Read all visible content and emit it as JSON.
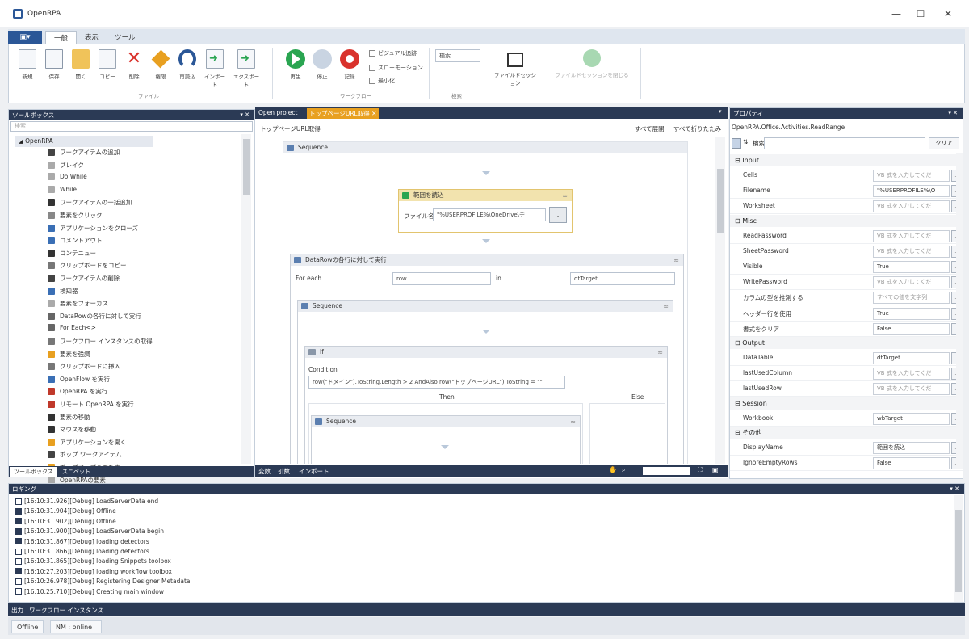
{
  "window": {
    "title": "OpenRPA",
    "controls": [
      "—",
      "☐",
      "✕"
    ]
  },
  "ribbon": {
    "file_label": "▣▾",
    "tabs": [
      "一般",
      "表示",
      "ツール"
    ],
    "buttons": [
      {
        "label": "新規",
        "icon": "new-document-icon"
      },
      {
        "label": "保存",
        "icon": "save-icon"
      },
      {
        "label": "開く",
        "icon": "open-folder-icon"
      },
      {
        "label": "コピー",
        "icon": "copy-icon"
      },
      {
        "label": "削除",
        "icon": "delete-icon"
      },
      {
        "label": "権限",
        "icon": "permissions-icon"
      },
      {
        "label": "再読込",
        "icon": "reload-icon"
      },
      {
        "label": "インポート",
        "icon": "import-icon"
      },
      {
        "label": "エクスポート",
        "icon": "export-icon"
      },
      {
        "label": "再生",
        "icon": "play-icon"
      },
      {
        "label": "停止",
        "icon": "stop-icon"
      },
      {
        "label": "記録",
        "icon": "record-icon"
      }
    ],
    "checkboxes": [
      "ビジュアル追跡",
      "スローモーション",
      "最小化"
    ],
    "search_value": "検索",
    "recording_buttons": [
      "ファイルドセッション",
      "ファイルドセッションを閉じる"
    ],
    "groups": [
      "ファイル",
      "ワークフロー",
      "検索"
    ],
    "colors": {
      "file_button": "#2b5797",
      "play": "#2aa551",
      "record": "#d9322c"
    }
  },
  "toolbox": {
    "title": "ツールボックス",
    "search_placeholder": "検索",
    "category": "OpenRPA",
    "items": [
      {
        "label": "ワークアイテムの追加",
        "color": "#444"
      },
      {
        "label": "ブレイク",
        "color": "#aaa"
      },
      {
        "label": "Do While",
        "color": "#aaa"
      },
      {
        "label": "While",
        "color": "#aaa"
      },
      {
        "label": "ワークアイテムの一括追加",
        "color": "#333"
      },
      {
        "label": "要素をクリック",
        "color": "#888"
      },
      {
        "label": "アプリケーションをクローズ",
        "color": "#3a6fb5"
      },
      {
        "label": "コメントアウト",
        "color": "#3a6fb5"
      },
      {
        "label": "コンテニュー",
        "color": "#333"
      },
      {
        "label": "クリップボードをコピー",
        "color": "#777"
      },
      {
        "label": "ワークアイテムの削除",
        "color": "#444"
      },
      {
        "label": "検知器",
        "color": "#3a6fb5"
      },
      {
        "label": "要素をフォーカス",
        "color": "#aaa"
      },
      {
        "label": "DataRowの各行に対して実行",
        "color": "#666"
      },
      {
        "label": "For Each<>",
        "color": "#666"
      },
      {
        "label": "ワークフロー インスタンスの取得",
        "color": "#777"
      },
      {
        "label": "要素を強調",
        "color": "#e8a020"
      },
      {
        "label": "クリップボードに挿入",
        "color": "#777"
      },
      {
        "label": "OpenFlow を実行",
        "color": "#3a6fb5"
      },
      {
        "label": "OpenRPA を実行",
        "color": "#c0392b"
      },
      {
        "label": "リモート OpenRPA を実行",
        "color": "#c0392b"
      },
      {
        "label": "要素の移動",
        "color": "#333"
      },
      {
        "label": "マウスを移動",
        "color": "#333"
      },
      {
        "label": "アプリケーションを開く",
        "color": "#e8a020"
      },
      {
        "label": "ポップ ワークアイテム",
        "color": "#444"
      },
      {
        "label": "ポップアップ画面を表示",
        "color": "#e8a020"
      },
      {
        "label": "OpenRPAの要素",
        "color": "#aaa"
      }
    ],
    "bottom_tabs": [
      "ツールボックス",
      "スニペット"
    ]
  },
  "designer": {
    "tabs": [
      "Open project",
      "トップページURL取得 ✕"
    ],
    "breadcrumb": "トップページURL取得",
    "expand_all": "すべて展開",
    "collapse_all": "すべて折りたたみ",
    "outer_sequence": "Sequence",
    "read_range": {
      "title": "範囲を読込",
      "file_label": "ファイル名",
      "file_value": "\"%USERPROFILE%\\OneDrive\\デ",
      "browse": "..."
    },
    "foreach": {
      "title": "DataRowの各行に対して実行",
      "for_each_label": "For each",
      "item_value": "row",
      "in_label": "in",
      "collection_value": "dtTarget"
    },
    "inner_sequence": "Sequence",
    "if_block": {
      "title": "If",
      "condition_label": "Condition",
      "condition_value": "row(\"ドメイン\").ToString.Length > 2 AndAlso row(\"トップページURL\").ToString = \"\"",
      "then_label": "Then",
      "else_label": "Else",
      "then_sequence": "Sequence"
    },
    "bottom_tabs": [
      "変数",
      "引数",
      "インポート"
    ],
    "zoom_value": ""
  },
  "properties": {
    "title": "プロパティ",
    "type_name": "OpenRPA.Office.Activities.ReadRange",
    "search_label": "検索:",
    "clear_label": "クリア",
    "categories": [
      {
        "name": "Input",
        "rows": [
          {
            "name": "Cells",
            "value": "VB 式を入力してくだ",
            "dark": false
          },
          {
            "name": "Filename",
            "value": "\"%USERPROFILE%\\O",
            "dark": true
          },
          {
            "name": "Worksheet",
            "value": "VB 式を入力してくだ",
            "dark": false
          }
        ]
      },
      {
        "name": "Misc",
        "rows": [
          {
            "name": "ReadPassword",
            "value": "VB 式を入力してくだ",
            "dark": false
          },
          {
            "name": "SheetPassword",
            "value": "VB 式を入力してくだ",
            "dark": false
          },
          {
            "name": "Visible",
            "value": "True",
            "dark": true
          },
          {
            "name": "WritePassword",
            "value": "VB 式を入力してくだ",
            "dark": false
          },
          {
            "name": "カラムの型を推測する",
            "value": "すべての値を文字列",
            "dark": false
          },
          {
            "name": "ヘッダー行を使用",
            "value": "True",
            "dark": true
          },
          {
            "name": "書式をクリア",
            "value": "False",
            "dark": true
          }
        ]
      },
      {
        "name": "Output",
        "rows": [
          {
            "name": "DataTable",
            "value": "dtTarget",
            "dark": true
          },
          {
            "name": "lastUsedColumn",
            "value": "VB 式を入力してくだ",
            "dark": false
          },
          {
            "name": "lastUsedRow",
            "value": "VB 式を入力してくだ",
            "dark": false
          }
        ]
      },
      {
        "name": "Session",
        "rows": [
          {
            "name": "Workbook",
            "value": "wbTarget",
            "dark": true
          }
        ]
      },
      {
        "name": "その他",
        "rows": [
          {
            "name": "DisplayName",
            "value": "範囲を読込",
            "dark": true
          },
          {
            "name": "IgnoreEmptyRows",
            "value": "False",
            "dark": true
          }
        ]
      }
    ]
  },
  "logging": {
    "title": "ロギング",
    "lines": [
      {
        "text": "[16:10:31.926][Debug] LoadServerData end",
        "checked": false
      },
      {
        "text": "[16:10:31.904][Debug] Offline",
        "checked": true
      },
      {
        "text": "[16:10:31.902][Debug] Offline",
        "checked": true
      },
      {
        "text": "[16:10:31.900][Debug] LoadServerData begin",
        "checked": true
      },
      {
        "text": "[16:10:31.867][Debug] loading detectors",
        "checked": true
      },
      {
        "text": "[16:10:31.866][Debug] loading detectors",
        "checked": false
      },
      {
        "text": "[16:10:31.865][Debug] loading Snippets toolbox",
        "checked": false
      },
      {
        "text": "[16:10:27.203][Debug] loading workflow toolbox",
        "checked": true
      },
      {
        "text": "[16:10:26.978][Debug] Registering Designer Metadata",
        "checked": false
      },
      {
        "text": "[16:10:25.710][Debug] Creating main window",
        "checked": false
      }
    ],
    "bottom_tabs": [
      "出力",
      "ワークフロー インスタンス"
    ]
  },
  "status": {
    "items": [
      "Offline",
      "NM : online"
    ]
  }
}
